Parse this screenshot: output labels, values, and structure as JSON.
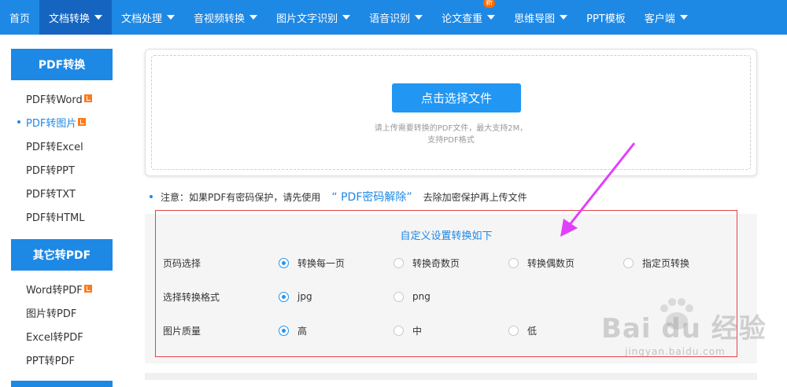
{
  "nav": {
    "items": [
      {
        "label": "首页",
        "caret": false,
        "active": false
      },
      {
        "label": "文档转换",
        "caret": true,
        "active": true
      },
      {
        "label": "文档处理",
        "caret": true,
        "active": false
      },
      {
        "label": "音视频转换",
        "caret": true,
        "active": false
      },
      {
        "label": "图片文字识别",
        "caret": true,
        "active": false
      },
      {
        "label": "语音识别",
        "caret": true,
        "active": false
      },
      {
        "label": "论文查重",
        "caret": true,
        "active": false,
        "badge": "新"
      },
      {
        "label": "思维导图",
        "caret": true,
        "active": false
      },
      {
        "label": "PPT模板",
        "caret": false,
        "active": false
      },
      {
        "label": "客户端",
        "caret": true,
        "active": false
      }
    ]
  },
  "sidebar": {
    "pdf_header": "PDF转换",
    "pdf_items": [
      {
        "label": "PDF转Word",
        "vip": true,
        "active": false
      },
      {
        "label": "PDF转图片",
        "vip": true,
        "active": true
      },
      {
        "label": "PDF转Excel",
        "vip": false,
        "active": false
      },
      {
        "label": "PDF转PPT",
        "vip": false,
        "active": false
      },
      {
        "label": "PDF转TXT",
        "vip": false,
        "active": false
      },
      {
        "label": "PDF转HTML",
        "vip": false,
        "active": false
      }
    ],
    "other_header": "其它转PDF",
    "other_items": [
      {
        "label": "Word转PDF",
        "vip": true
      },
      {
        "label": "图片转PDF",
        "vip": false
      },
      {
        "label": "Excel转PDF",
        "vip": false
      },
      {
        "label": "PPT转PDF",
        "vip": false
      }
    ]
  },
  "upload": {
    "button_label": "点击选择文件",
    "hint_line1": "请上传需要转换的PDF文件，最大支持2M，",
    "hint_line2": "支持PDF格式"
  },
  "note": {
    "prefix": "注意：如果PDF有密码保护，请先使用",
    "link": "“ PDF密码解除”",
    "suffix": "去除加密保护再上传文件"
  },
  "settings": {
    "title": "自定义设置转换如下",
    "page_label": "页码选择",
    "page_options": [
      "转换每一页",
      "转换奇数页",
      "转换偶数页",
      "指定页转换"
    ],
    "page_selected": 0,
    "format_label": "选择转换格式",
    "format_options": [
      "jpg",
      "png"
    ],
    "format_selected": 0,
    "quality_label": "图片质量",
    "quality_options": [
      "高",
      "中",
      "低"
    ],
    "quality_selected": 0
  },
  "watermark": {
    "brand": "Bai du 经验",
    "url": "jingyan.baidu.com"
  },
  "colors": {
    "primary": "#1e88e5",
    "nav_active": "#1565c0",
    "frame_red": "#e8414a",
    "arrow_magenta": "#e040fb"
  }
}
